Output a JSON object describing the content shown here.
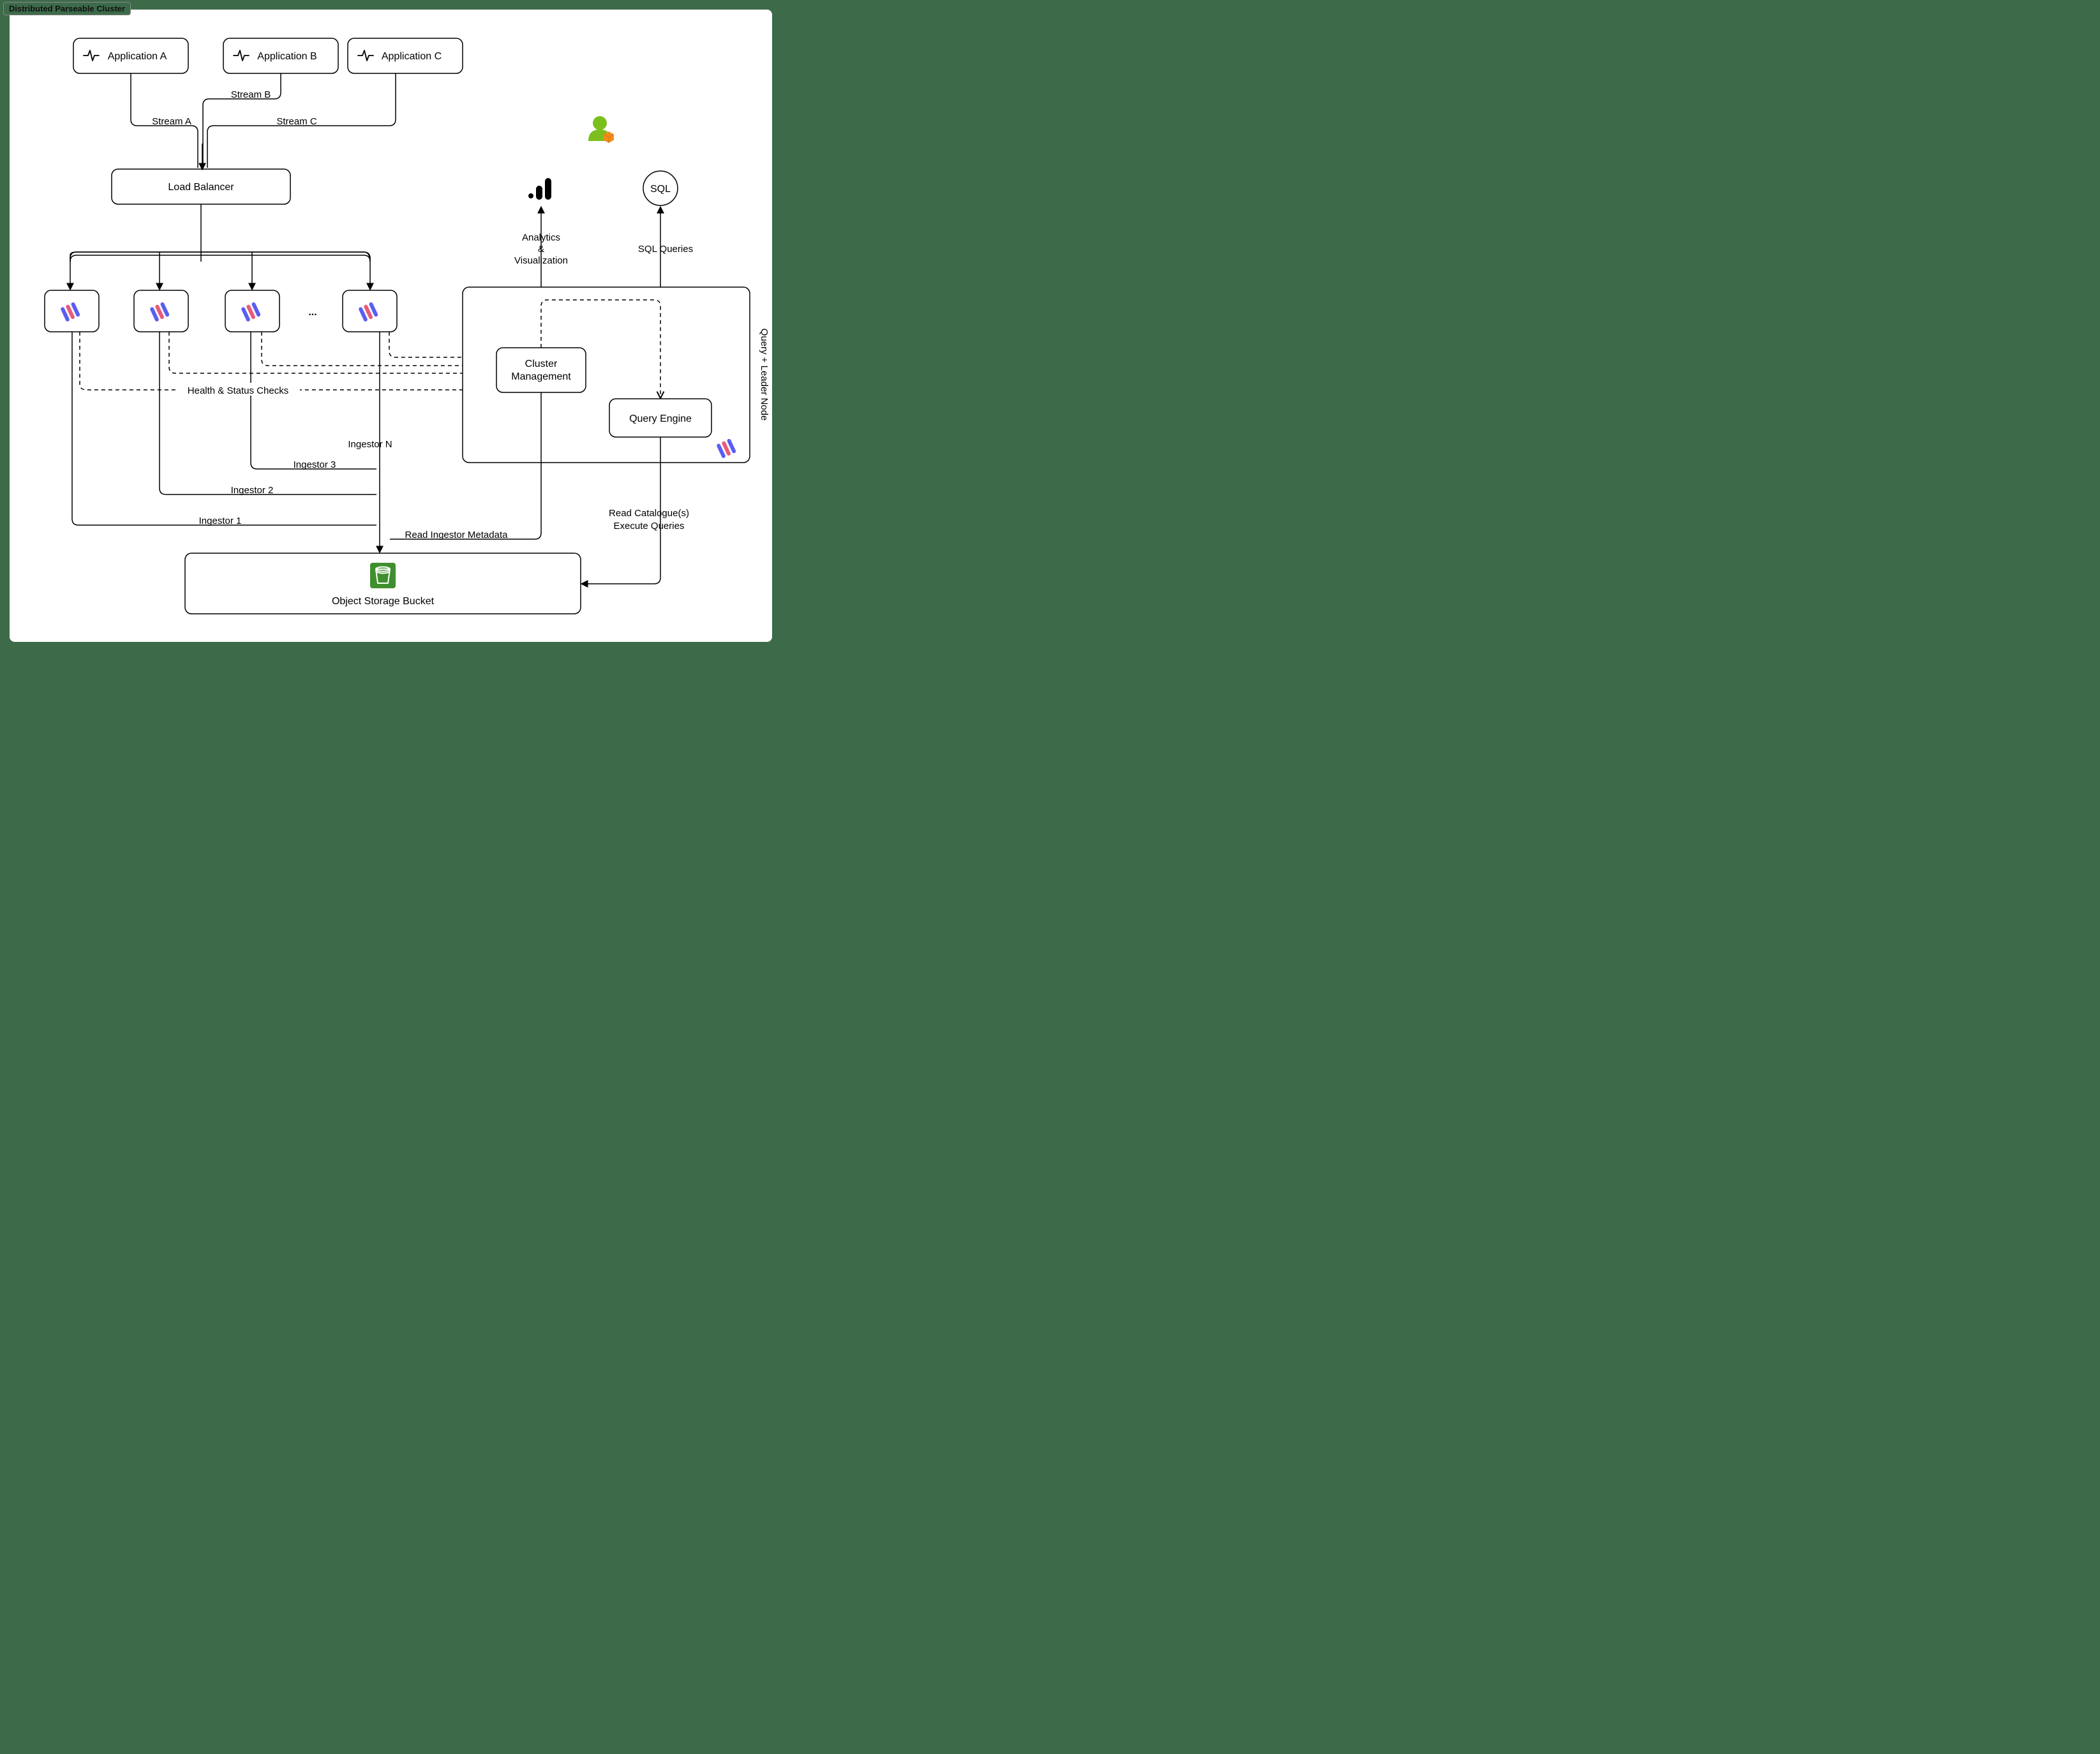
{
  "title": "Distributed Parseable Cluster",
  "apps": {
    "a": {
      "label": "Application A",
      "stream": "Stream A"
    },
    "b": {
      "label": "Application B",
      "stream": "Stream B"
    },
    "c": {
      "label": "Application C",
      "stream": "Stream C"
    }
  },
  "load_balancer": {
    "label": "Load Balancer"
  },
  "ellipsis": "...",
  "ingestors": {
    "i1": "Ingestor 1",
    "i2": "Ingestor 2",
    "i3": "Ingestor 3",
    "in": "Ingestor N"
  },
  "edges": {
    "health": "Health & Status Checks",
    "read_ing_meta": "Read Ingestor Metadata",
    "analytics1": "Analytics",
    "analytics2": "&",
    "analytics3": "Visualization",
    "sql_queries": "SQL Queries",
    "read_cat1": "Read Catalogue(s)",
    "read_cat2": "Execute Queries"
  },
  "leader": {
    "side_label": "Query + Leader Node",
    "cluster_mgmt": "Cluster Management",
    "query_engine": "Query Engine"
  },
  "sql_node": "SQL",
  "storage": "Object Storage Bucket",
  "colors": {
    "page_bg": "#3d6b4a",
    "user_green": "#7bbf1e",
    "user_orange": "#f28c1e",
    "bucket_green": "#3f8f2f",
    "parseable_blue": "#5a5ef0",
    "parseable_red": "#e85a7a"
  }
}
